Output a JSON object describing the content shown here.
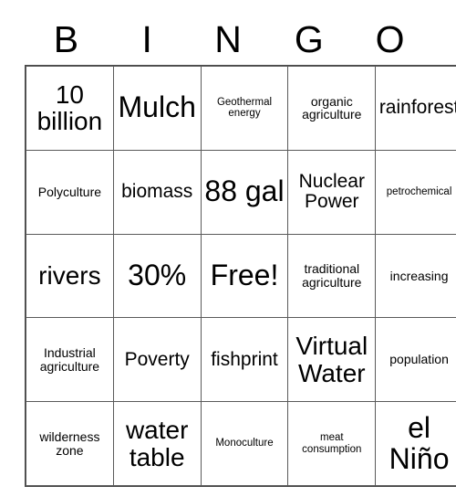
{
  "card": {
    "header": {
      "letters": [
        "B",
        "I",
        "N",
        "G",
        "O"
      ]
    },
    "rows": [
      [
        {
          "text": "10 billion",
          "size": "lg"
        },
        {
          "text": "Mulch",
          "size": "xl"
        },
        {
          "text": "Geothermal energy",
          "size": "xs"
        },
        {
          "text": "organic agriculture",
          "size": "sm"
        },
        {
          "text": "rainforest",
          "size": "md"
        }
      ],
      [
        {
          "text": "Polyculture",
          "size": "sm"
        },
        {
          "text": "biomass",
          "size": "md"
        },
        {
          "text": "88 gal",
          "size": "xl"
        },
        {
          "text": "Nuclear Power",
          "size": "md"
        },
        {
          "text": "petrochemical",
          "size": "xs"
        }
      ],
      [
        {
          "text": "rivers",
          "size": "lg"
        },
        {
          "text": "30%",
          "size": "xl"
        },
        {
          "text": "Free!",
          "size": "xl"
        },
        {
          "text": "traditional agriculture",
          "size": "sm"
        },
        {
          "text": "increasing",
          "size": "sm"
        }
      ],
      [
        {
          "text": "Industrial agriculture",
          "size": "sm"
        },
        {
          "text": "Poverty",
          "size": "md"
        },
        {
          "text": "fishprint",
          "size": "md"
        },
        {
          "text": "Virtual Water",
          "size": "lg"
        },
        {
          "text": "population",
          "size": "sm"
        }
      ],
      [
        {
          "text": "wilderness zone",
          "size": "sm"
        },
        {
          "text": "water table",
          "size": "lg"
        },
        {
          "text": "Monoculture",
          "size": "xs"
        },
        {
          "text": "meat consumption",
          "size": "xs"
        },
        {
          "text": "el Niño",
          "size": "xl"
        }
      ]
    ]
  },
  "colors": {
    "border": "#5a5a5a",
    "text": "#000000",
    "background": "#ffffff"
  }
}
